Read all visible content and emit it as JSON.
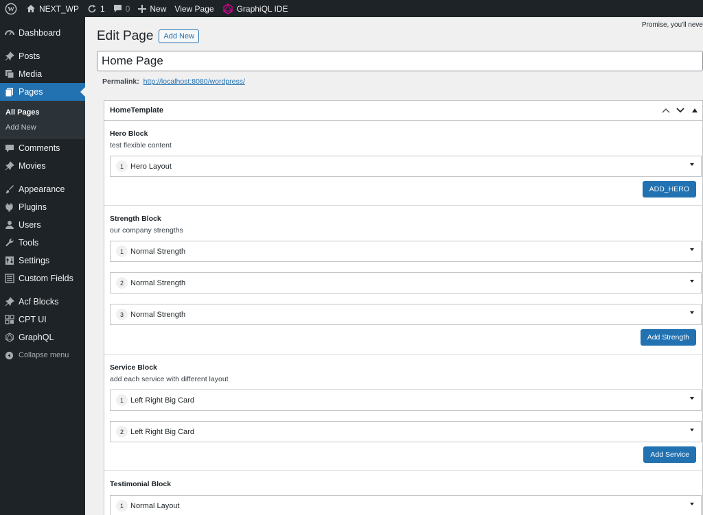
{
  "adminbar": {
    "site_name": "NEXT_WP",
    "updates_count": "1",
    "comments_count": "0",
    "new_label": "New",
    "view_page_label": "View Page",
    "graphql_label": "GraphiQL IDE"
  },
  "sidebar": {
    "items": [
      {
        "label": "Dashboard",
        "icon": "dashboard-icon"
      },
      {
        "label": "Posts",
        "icon": "pin-icon"
      },
      {
        "label": "Media",
        "icon": "media-icon"
      },
      {
        "label": "Pages",
        "icon": "pages-icon"
      },
      {
        "label": "Comments",
        "icon": "comment-icon"
      },
      {
        "label": "Movies",
        "icon": "pin-icon"
      },
      {
        "label": "Appearance",
        "icon": "brush-icon"
      },
      {
        "label": "Plugins",
        "icon": "plugin-icon"
      },
      {
        "label": "Users",
        "icon": "user-icon"
      },
      {
        "label": "Tools",
        "icon": "wrench-icon"
      },
      {
        "label": "Settings",
        "icon": "settings-icon"
      },
      {
        "label": "Custom Fields",
        "icon": "fields-icon"
      },
      {
        "label": "Acf Blocks",
        "icon": "pin-icon"
      },
      {
        "label": "CPT UI",
        "icon": "grid-icon"
      },
      {
        "label": "GraphQL",
        "icon": "graphql-icon"
      },
      {
        "label": "Collapse menu",
        "icon": "collapse-icon"
      }
    ],
    "submenu": {
      "all_pages": "All Pages",
      "add_new": "Add New"
    }
  },
  "header": {
    "promise_text": "Promise, you'll neve",
    "title": "Edit Page",
    "add_new": "Add New"
  },
  "post": {
    "title": "Home Page",
    "permalink_label": "Permalink:",
    "permalink_url": "http://localhost:8080/wordpress/"
  },
  "panel": {
    "title": "HomeTemplate",
    "blocks": [
      {
        "label": "Hero Block",
        "desc": "test flexible content",
        "layouts": [
          {
            "num": "1",
            "name": "Hero Layout"
          }
        ],
        "button": "ADD_HERO"
      },
      {
        "label": "Strength Block",
        "desc": "our company strengths",
        "layouts": [
          {
            "num": "1",
            "name": "Normal Strength"
          },
          {
            "num": "2",
            "name": "Normal Strength"
          },
          {
            "num": "3",
            "name": "Normal Strength"
          }
        ],
        "button": "Add Strength"
      },
      {
        "label": "Service Block",
        "desc": "add each service with different layout",
        "layouts": [
          {
            "num": "1",
            "name": "Left Right Big Card"
          },
          {
            "num": "2",
            "name": "Left Right Big Card"
          }
        ],
        "button": "Add Service"
      },
      {
        "label": "Testimonial Block",
        "desc": "",
        "layouts": [
          {
            "num": "1",
            "name": "Normal Layout"
          }
        ],
        "button": ""
      }
    ]
  }
}
